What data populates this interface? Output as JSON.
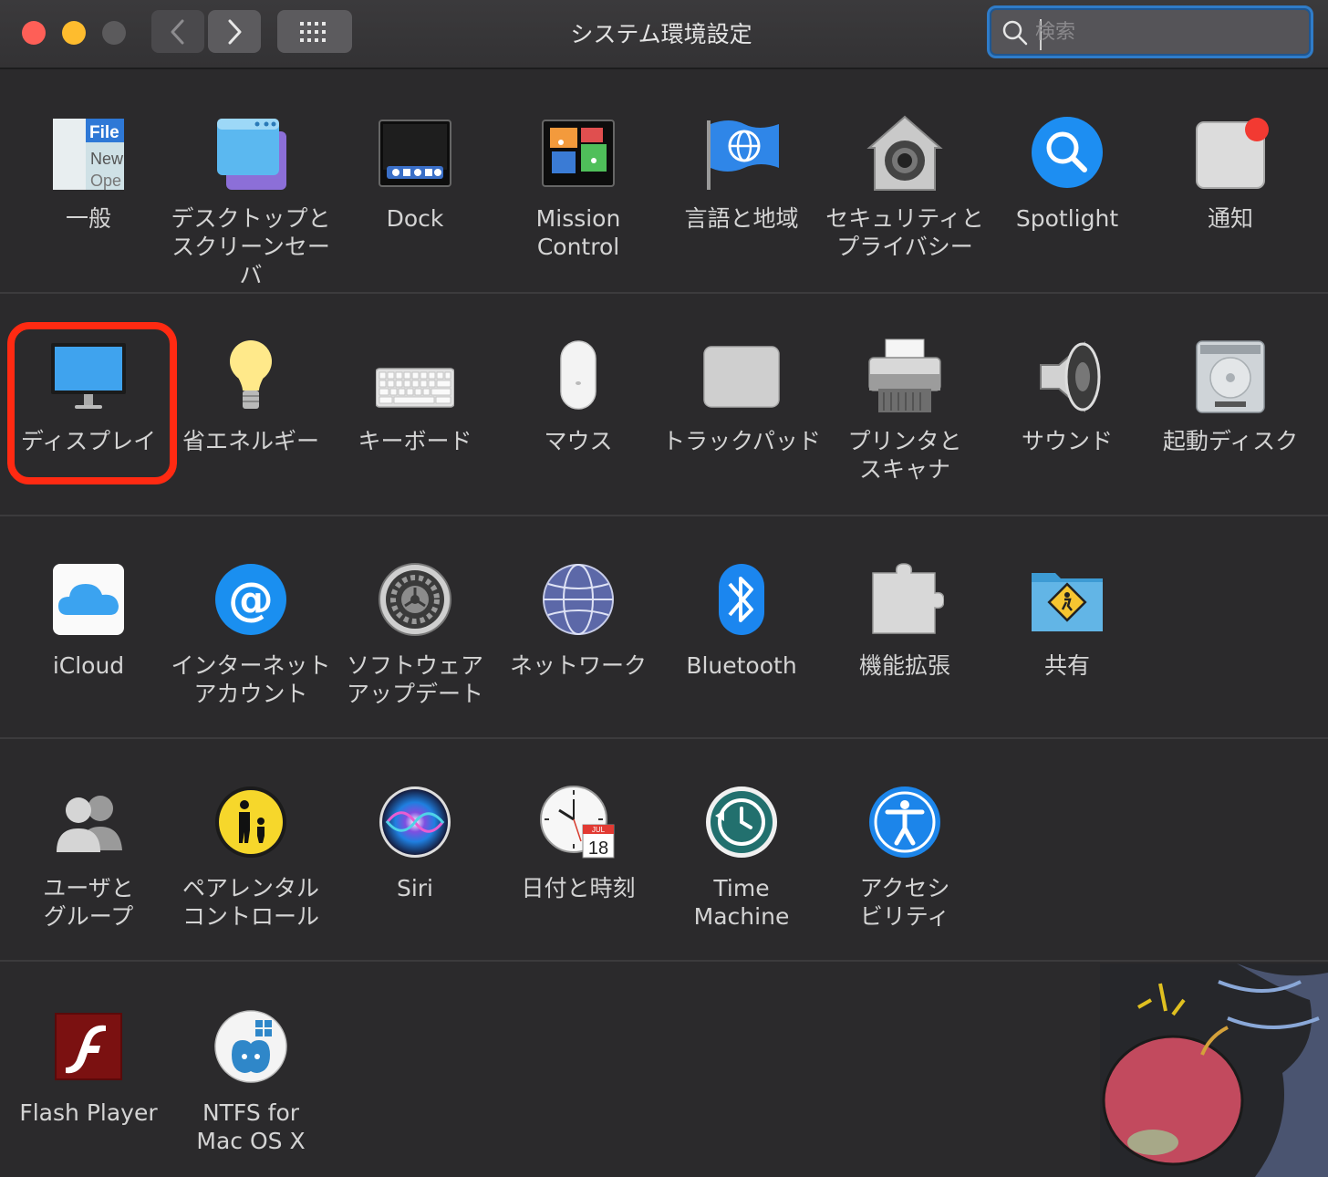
{
  "window": {
    "title": "システム環境設定",
    "search_placeholder": "検索"
  },
  "rows": [
    [
      {
        "label": "一般",
        "icon": "general-icon"
      },
      {
        "label": "デスクトップと\nスクリーンセーバ",
        "icon": "desktop-screensaver-icon"
      },
      {
        "label": "Dock",
        "icon": "dock-icon"
      },
      {
        "label": "Mission\nControl",
        "icon": "mission-control-icon"
      },
      {
        "label": "言語と地域",
        "icon": "language-region-icon"
      },
      {
        "label": "セキュリティと\nプライバシー",
        "icon": "security-privacy-icon"
      },
      {
        "label": "Spotlight",
        "icon": "spotlight-icon"
      },
      {
        "label": "通知",
        "icon": "notifications-icon"
      }
    ],
    [
      {
        "label": "ディスプレイ",
        "icon": "display-icon"
      },
      {
        "label": "省エネルギー",
        "icon": "energy-saver-icon"
      },
      {
        "label": "キーボード",
        "icon": "keyboard-icon"
      },
      {
        "label": "マウス",
        "icon": "mouse-icon"
      },
      {
        "label": "トラックパッド",
        "icon": "trackpad-icon"
      },
      {
        "label": "プリンタと\nスキャナ",
        "icon": "printer-scanner-icon"
      },
      {
        "label": "サウンド",
        "icon": "sound-icon"
      },
      {
        "label": "起動ディスク",
        "icon": "startup-disk-icon"
      }
    ],
    [
      {
        "label": "iCloud",
        "icon": "icloud-icon"
      },
      {
        "label": "インターネット\nアカウント",
        "icon": "internet-accounts-icon"
      },
      {
        "label": "ソフトウェア\nアップデート",
        "icon": "software-update-icon"
      },
      {
        "label": "ネットワーク",
        "icon": "network-icon"
      },
      {
        "label": "Bluetooth",
        "icon": "bluetooth-icon"
      },
      {
        "label": "機能拡張",
        "icon": "extensions-icon"
      },
      {
        "label": "共有",
        "icon": "sharing-icon"
      }
    ],
    [
      {
        "label": "ユーザと\nグループ",
        "icon": "users-groups-icon"
      },
      {
        "label": "ペアレンタル\nコントロール",
        "icon": "parental-controls-icon"
      },
      {
        "label": "Siri",
        "icon": "siri-icon"
      },
      {
        "label": "日付と時刻",
        "icon": "date-time-icon"
      },
      {
        "label": "Time\nMachine",
        "icon": "time-machine-icon"
      },
      {
        "label": "アクセシ\nビリティ",
        "icon": "accessibility-icon"
      }
    ],
    [
      {
        "label": "Flash Player",
        "icon": "flash-player-icon"
      },
      {
        "label": "NTFS for\nMac OS X",
        "icon": "ntfs-icon"
      }
    ]
  ],
  "icon_text": {
    "general_file": "File",
    "general_new": "New",
    "general_open": "Ope",
    "calendar_month": "JUL",
    "calendar_day": "18"
  },
  "colors": {
    "highlight": "#ff2a12",
    "search_focus": "#2f7cc9"
  }
}
